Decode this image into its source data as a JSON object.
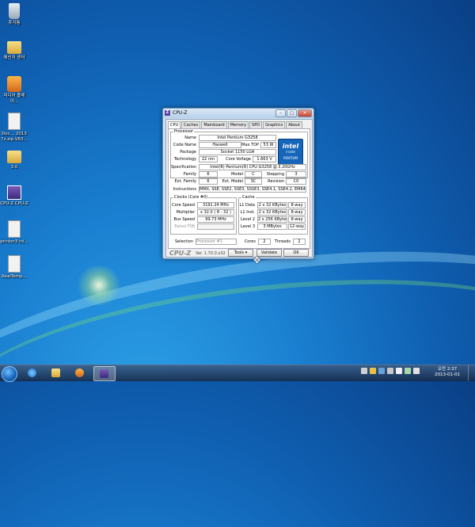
{
  "desktop_icons": [
    {
      "label": "휴지통",
      "icon": "recycle-bin-icon"
    },
    {
      "label": "에신저 센터",
      "icon": "folder-icon"
    },
    {
      "label": "미디어 플레이...",
      "icon": "media-player-icon"
    },
    {
      "label": "Doc… 2013 7z.zip.V63...",
      "icon": "archive-icon"
    },
    {
      "label": "3.0",
      "icon": "folder-icon"
    },
    {
      "label": "CPU-Z CPU-Z",
      "icon": "cpuz-icon"
    },
    {
      "label": "printer3 ini...",
      "icon": "document-icon"
    },
    {
      "label": "RealTemp...",
      "icon": "document-icon"
    }
  ],
  "window": {
    "title": "CPU-Z",
    "tabs": [
      "CPU",
      "Caches",
      "Mainboard",
      "Memory",
      "SPD",
      "Graphics",
      "About"
    ],
    "active_tab": "CPU",
    "processor": {
      "legend": "Processor",
      "name_label": "Name",
      "name": "Intel Pentium G3258",
      "codename_label": "Code Name",
      "codename": "Haswell",
      "maxtdp_label": "Max TDP",
      "maxtdp": "53 W",
      "package_label": "Package",
      "package": "Socket 1150 LGA",
      "technology_label": "Technology",
      "technology": "22 nm",
      "corevoltage_label": "Core Voltage",
      "corevoltage": "1.663 V"
    },
    "intel_badge": {
      "brand": "intel",
      "inside": "inside",
      "model": "PENTIUM"
    },
    "spec_label": "Specification",
    "spec": "Intel(R) Pentium(R) CPU G3258 @ 3.20GHz",
    "family_label": "Family",
    "family": "6",
    "model_label": "Model",
    "model": "C",
    "stepping_label": "Stepping",
    "stepping": "3",
    "extfamily_label": "Ext. Family",
    "extfamily": "6",
    "extmodel_label": "Ext. Model",
    "extmodel": "3C",
    "revision_label": "Revision",
    "revision": "C0",
    "instructions_label": "Instructions",
    "instructions": "MMX, SSE, SSE2, SSE3, SSSE3, SSE4.1, SSE4.2, EM64T, VT-x",
    "clocks": {
      "legend": "Clocks (Core #0)",
      "corespeed_label": "Core Speed",
      "corespeed": "3191.24 MHz",
      "multiplier_label": "Multiplier",
      "multiplier": "x 32.0 ( 8 - 32 )",
      "busspeed_label": "Bus Speed",
      "busspeed": "99.73 MHz",
      "ratedfsb_label": "Rated FSB",
      "ratedfsb": ""
    },
    "cache": {
      "legend": "Cache",
      "l1data_label": "L1 Data",
      "l1data": "2 x 32 KBytes",
      "l1data_way": "8-way",
      "l1inst_label": "L1 Inst.",
      "l1inst": "2 x 32 KBytes",
      "l1inst_way": "8-way",
      "l2_label": "Level 2",
      "l2": "2 x 256 KBytes",
      "l2_way": "8-way",
      "l3_label": "Level 3",
      "l3": "3 MBytes",
      "l3_way": "12-way"
    },
    "selection_label": "Selection",
    "selection": "Processor #1",
    "cores_label": "Cores",
    "cores": "2",
    "threads_label": "Threads",
    "threads": "2",
    "logo_text": "CPU-Z",
    "version": "Ver. 1.70.0.x32",
    "tools_label": "Tools",
    "validate_label": "Validate",
    "ok_label": "OK"
  },
  "taskbar": {
    "clock_time": "오전 2:37",
    "clock_date": "2013-01-01"
  }
}
